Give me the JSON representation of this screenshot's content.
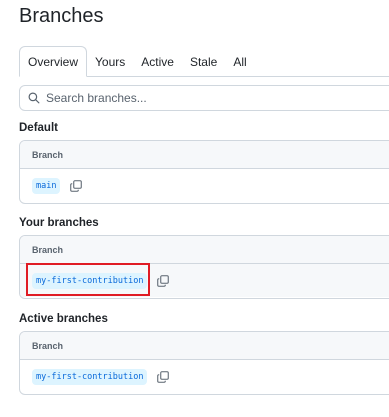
{
  "page": {
    "title": "Branches"
  },
  "tabs": [
    {
      "label": "Overview",
      "selected": true
    },
    {
      "label": "Yours",
      "selected": false
    },
    {
      "label": "Active",
      "selected": false
    },
    {
      "label": "Stale",
      "selected": false
    },
    {
      "label": "All",
      "selected": false
    }
  ],
  "search": {
    "placeholder": "Search branches...",
    "icon": "search-icon"
  },
  "sections": {
    "default": {
      "heading": "Default",
      "column_header": "Branch",
      "branches": [
        "main"
      ]
    },
    "yours": {
      "heading": "Your branches",
      "column_header": "Branch",
      "branches": [
        "my-first-contribution"
      ]
    },
    "active": {
      "heading": "Active branches",
      "column_header": "Branch",
      "branches": [
        "my-first-contribution"
      ]
    }
  },
  "colors": {
    "branch_label_text": "#0969da",
    "branch_label_bg": "#ddf4ff",
    "highlight_outline": "#e01b24",
    "border": "#d0d7de"
  }
}
